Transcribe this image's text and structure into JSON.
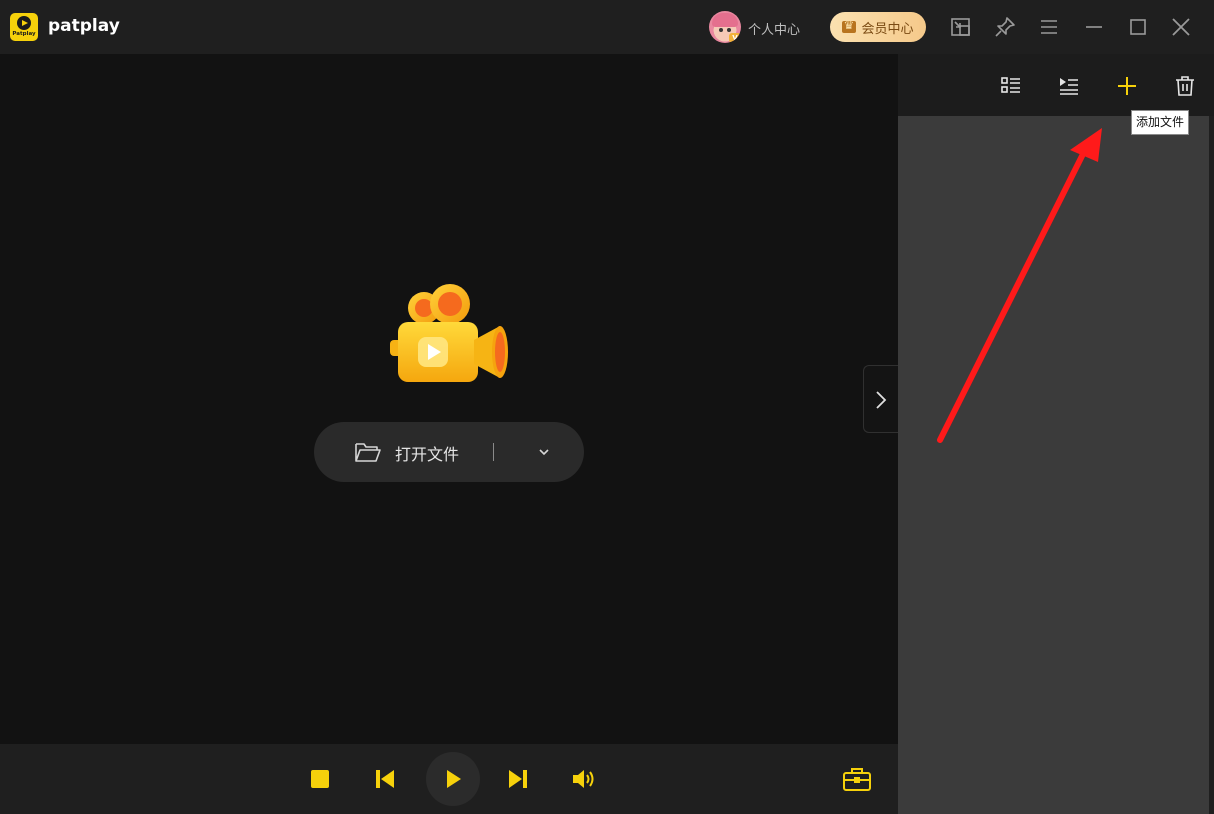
{
  "app": {
    "name": "patplay",
    "logo_text": "Patplay"
  },
  "header": {
    "personal_center": "个人中心",
    "avatar_badge": "V",
    "vip_center": "会员中心"
  },
  "main": {
    "open_file_label": "打开文件"
  },
  "playlist": {
    "tooltip_add_file": "添加文件"
  },
  "colors": {
    "accent": "#F6D10B",
    "titlebar_bg": "#1F1F1F",
    "video_bg": "#121212",
    "playlist_bg": "#3B3B3B",
    "annotation_arrow": "#FF1A1A"
  },
  "icons": {
    "titlebar": [
      "mini-mode-icon",
      "pin-icon",
      "menu-icon",
      "minimize-icon",
      "maximize-icon",
      "close-icon"
    ],
    "playlist_toolbar": [
      "list-view-icon",
      "playlist-mode-icon",
      "add-icon",
      "trash-icon"
    ],
    "controls": [
      "stop-icon",
      "previous-icon",
      "play-icon",
      "next-icon",
      "volume-icon",
      "toolbox-icon"
    ]
  }
}
